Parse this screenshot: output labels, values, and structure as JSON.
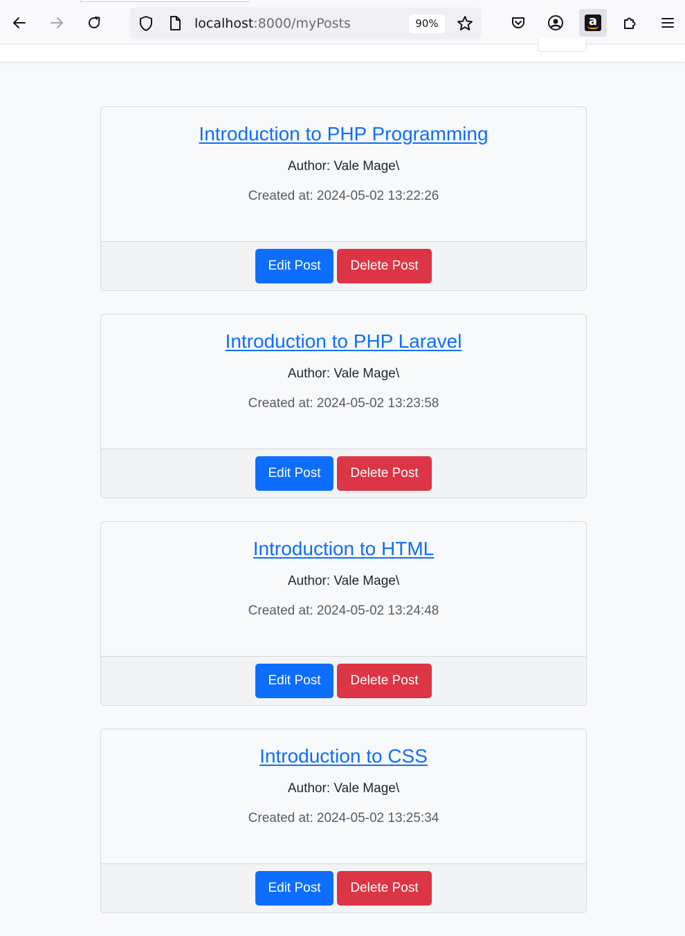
{
  "browser": {
    "url_host": "localhost",
    "url_path": ":8000/myPosts",
    "zoom": "90%"
  },
  "colors": {
    "link": "#0d6efd",
    "edit_button": "#0d6efd",
    "delete_button": "#dc3545"
  },
  "icons": {
    "back": "arrow-left",
    "forward": "arrow-right",
    "reload": "reload",
    "shield": "tracking-protection-shield",
    "page": "page-document",
    "bookmark": "star",
    "pocket": "pocket",
    "account": "account-circle",
    "amazon": "amazon-extension",
    "extensions": "puzzle-piece",
    "menu": "hamburger"
  },
  "posts": [
    {
      "title": "Introduction to PHP Programming",
      "author": "Author: Vale Mage\\",
      "created": "Created at: 2024-05-02 13:22:26",
      "edit_label": "Edit Post",
      "delete_label": "Delete Post"
    },
    {
      "title": "Introduction to PHP Laravel",
      "author": "Author: Vale Mage\\",
      "created": "Created at: 2024-05-02 13:23:58",
      "edit_label": "Edit Post",
      "delete_label": "Delete Post"
    },
    {
      "title": "Introduction to HTML",
      "author": "Author: Vale Mage\\",
      "created": "Created at: 2024-05-02 13:24:48",
      "edit_label": "Edit Post",
      "delete_label": "Delete Post"
    },
    {
      "title": "Introduction to CSS",
      "author": "Author: Vale Mage\\",
      "created": "Created at: 2024-05-02 13:25:34",
      "edit_label": "Edit Post",
      "delete_label": "Delete Post"
    }
  ]
}
